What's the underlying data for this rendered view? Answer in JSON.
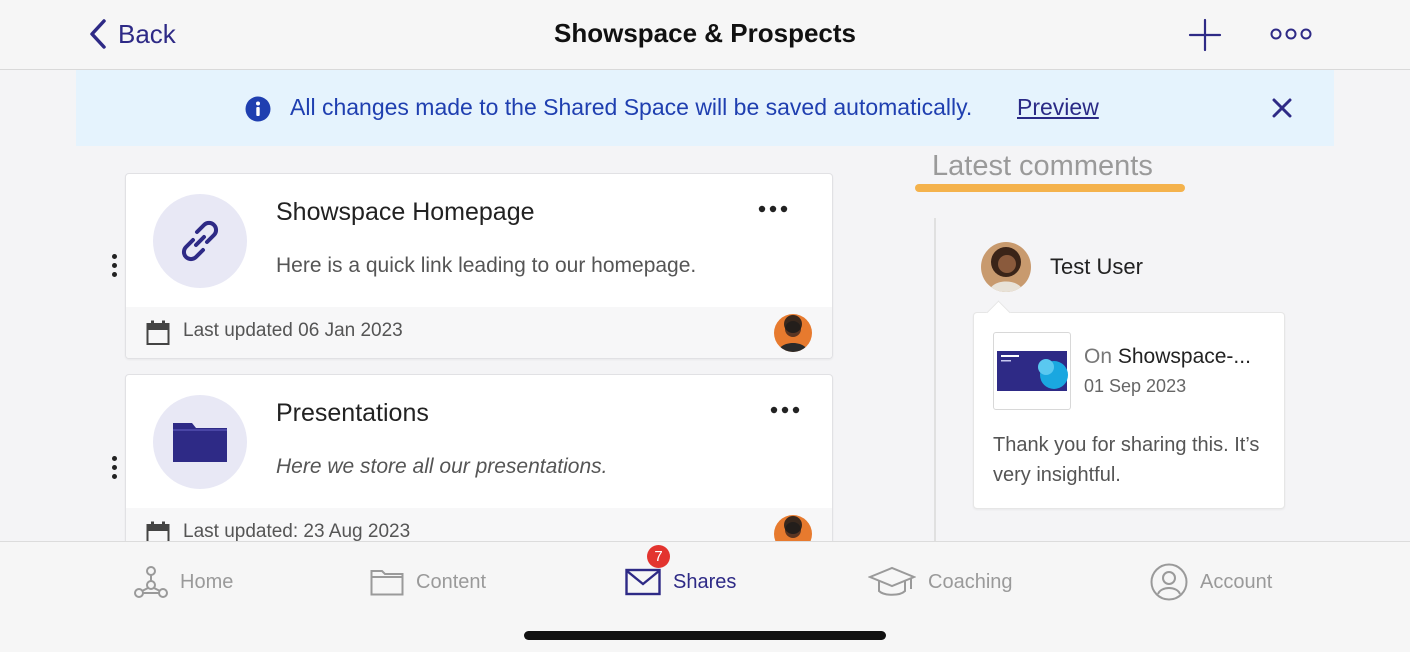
{
  "header": {
    "back_label": "Back",
    "title": "Showspace & Prospects"
  },
  "banner": {
    "message": "All changes made to the Shared Space will be saved automatically.",
    "preview_label": "Preview"
  },
  "cards": [
    {
      "title": "Showspace Homepage",
      "description": "Here is a quick link leading to our homepage.",
      "updated": "Last updated 06 Jan 2023",
      "icon": "link-icon"
    },
    {
      "title": "Presentations",
      "description": "Here we store all our presentations.",
      "updated": "Last updated: 23 Aug 2023",
      "icon": "folder-icon"
    }
  ],
  "comments": {
    "title": "Latest comments",
    "items": [
      {
        "user": "Test User",
        "on_prefix": "On",
        "target": "Showspace-...",
        "date": "01 Sep 2023",
        "text": "Thank you for sharing this. It’s very insightful."
      }
    ]
  },
  "nav": {
    "items": [
      {
        "label": "Home",
        "icon": "home-network-icon"
      },
      {
        "label": "Content",
        "icon": "folder-outline-icon"
      },
      {
        "label": "Shares",
        "icon": "mail-icon",
        "badge": "7"
      },
      {
        "label": "Coaching",
        "icon": "graduation-cap-icon"
      },
      {
        "label": "Account",
        "icon": "user-circle-icon"
      }
    ]
  },
  "colors": {
    "accent": "#2e2a86",
    "banner_bg": "#e5f3fd",
    "banner_text": "#1f3fb0",
    "highlight": "#f4b24c",
    "badge": "#e3342f"
  }
}
